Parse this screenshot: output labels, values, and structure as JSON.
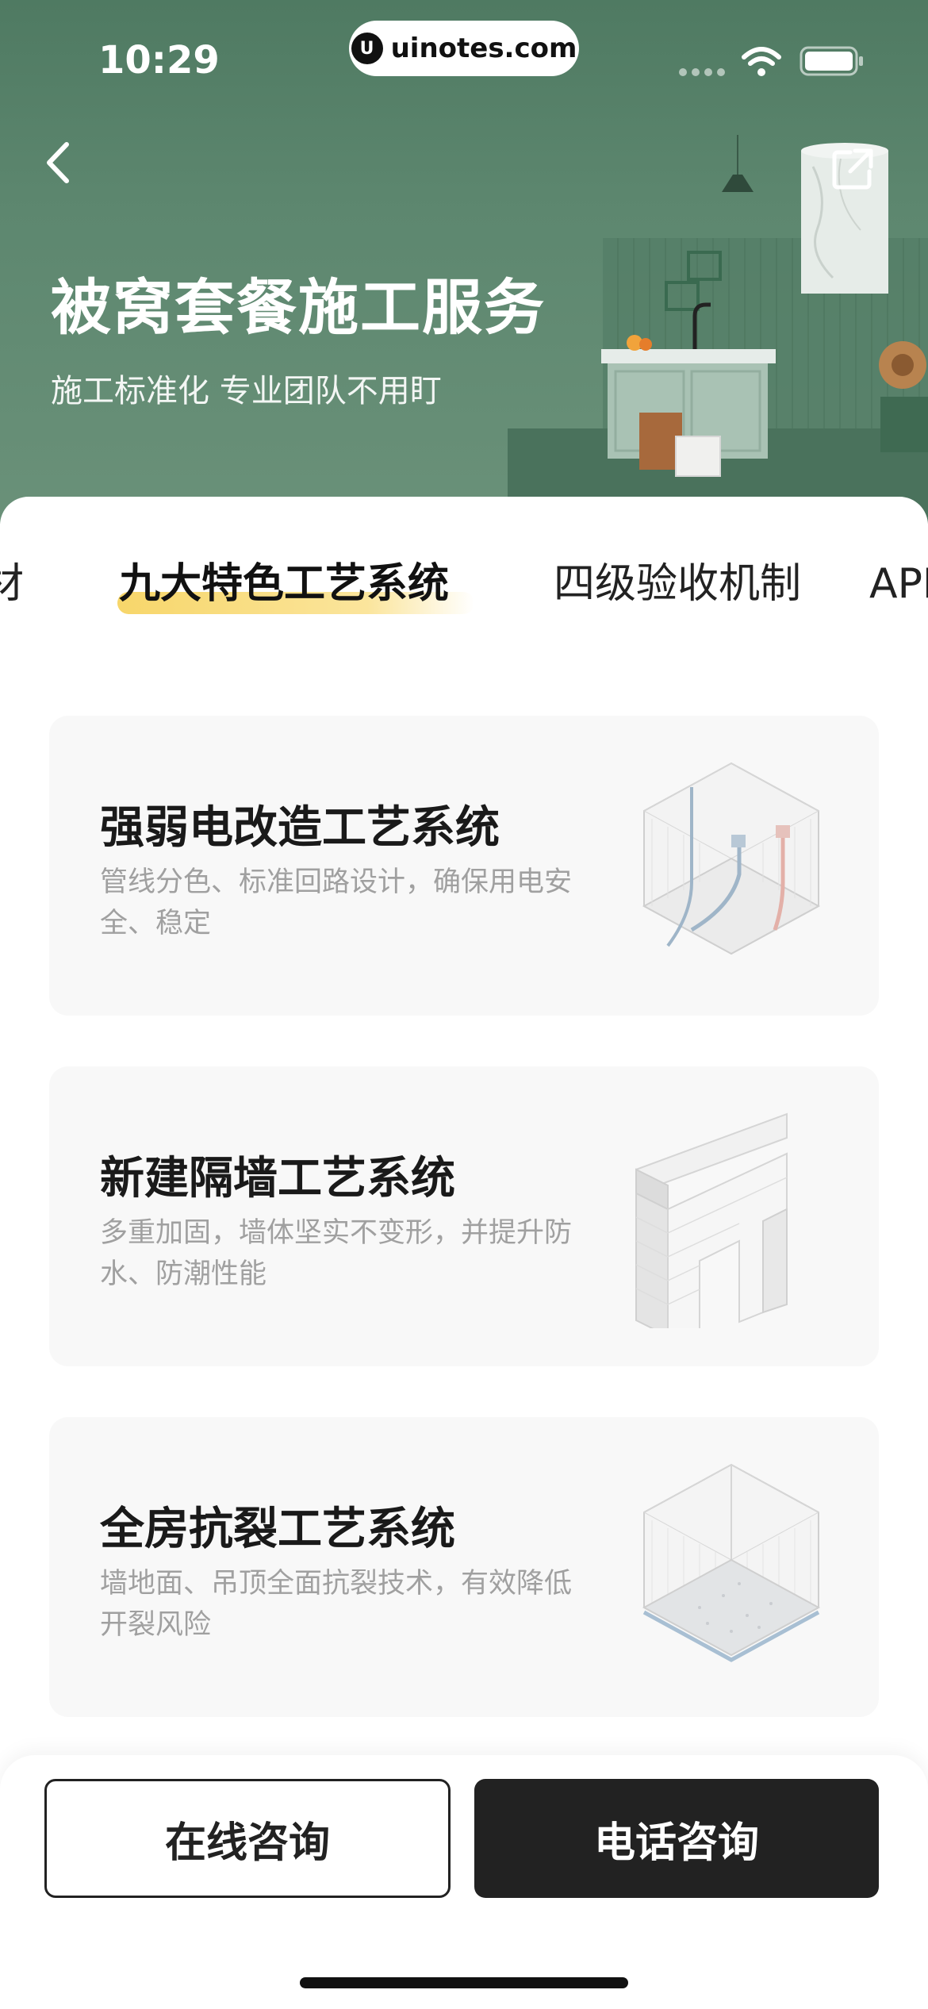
{
  "status_bar": {
    "time": "10:29",
    "url": "uinotes.com",
    "url_logo": "U"
  },
  "hero": {
    "title": "被窝套餐施工服务",
    "subtitle": "施工标准化 专业团队不用盯",
    "background_color": "#5a846c"
  },
  "tabs": [
    {
      "label": "材"
    },
    {
      "label": "九大特色工艺系统",
      "active": true
    },
    {
      "label": "四级验收机制"
    },
    {
      "label": "APP"
    }
  ],
  "cards": [
    {
      "title": "强弱电改造工艺系统",
      "description": "管线分色、标准回路设计，确保用电安全、稳定",
      "icon": "electrical-room-icon"
    },
    {
      "title": "新建隔墙工艺系统",
      "description": "多重加固，墙体坚实不变形，并提升防水、防潮性能",
      "icon": "partition-wall-icon"
    },
    {
      "title": "全房抗裂工艺系统",
      "description": "墙地面、吊顶全面抗裂技术，有效降低开裂风险",
      "icon": "anti-crack-room-icon"
    }
  ],
  "bottom_bar": {
    "online_label": "在线咨询",
    "phone_label": "电话咨询"
  },
  "colors": {
    "accent_highlight": "#f7d66a",
    "primary_dark": "#222222"
  }
}
